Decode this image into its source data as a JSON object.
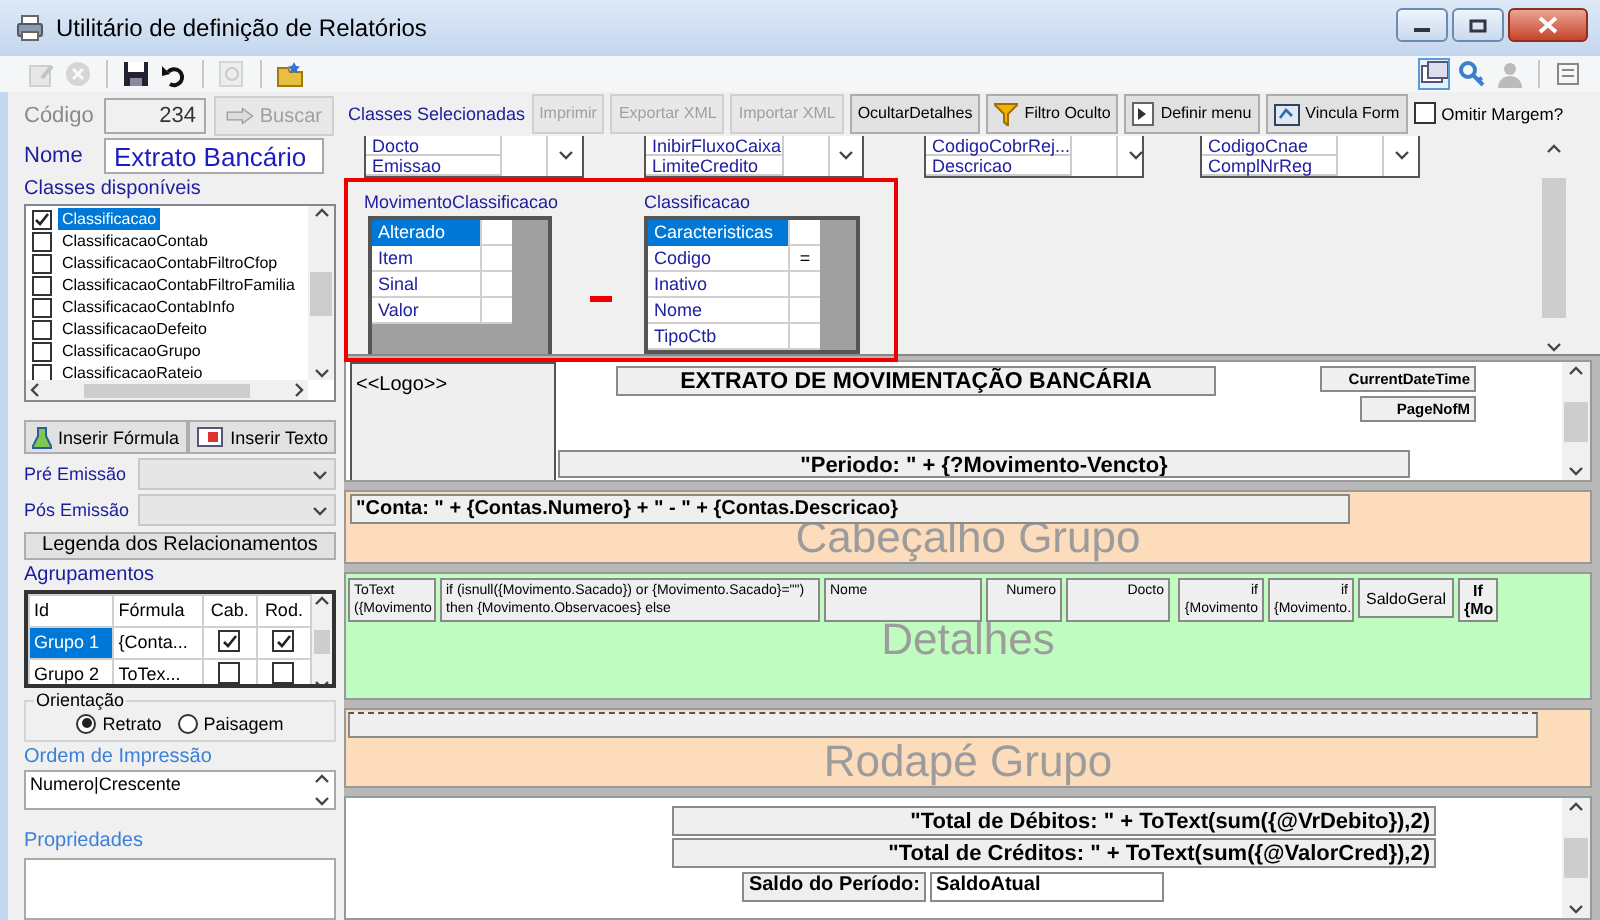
{
  "window": {
    "title": "Utilitário de definição de Relatórios"
  },
  "toolbar": [
    {
      "kind": "edit",
      "disabled": true
    },
    {
      "kind": "cancel",
      "disabled": true
    },
    {
      "kind": "save",
      "disabled": false
    },
    {
      "kind": "undo",
      "disabled": false
    },
    {
      "kind": "preview",
      "disabled": true
    },
    {
      "kind": "folder",
      "disabled": false
    }
  ],
  "right_tools": [
    {
      "kind": "windows",
      "selected": true
    },
    {
      "kind": "key",
      "selected": false
    },
    {
      "kind": "user",
      "selected": false
    },
    {
      "kind": "list",
      "selected": false
    }
  ],
  "codigo": {
    "label": "Código",
    "value": "234"
  },
  "buscar": {
    "label": "Buscar",
    "disabled": true
  },
  "nome": {
    "label": "Nome",
    "value": "Extrato Bancário"
  },
  "classes_selecionadas": {
    "label": "Classes Selecionadas"
  },
  "action_buttons": [
    {
      "label": "Imprimir",
      "kind": "plain",
      "disabled": true
    },
    {
      "label": "Exportar XML",
      "kind": "plain",
      "disabled": true
    },
    {
      "label": "Importar XML",
      "kind": "plain",
      "disabled": true
    },
    {
      "label": "OcultarDetalhes",
      "kind": "plain",
      "disabled": false
    },
    {
      "label": "Filtro Oculto",
      "kind": "filter",
      "disabled": false
    },
    {
      "label": "Definir menu",
      "kind": "menu",
      "disabled": false
    },
    {
      "label": "Vincula Form",
      "kind": "form",
      "disabled": false
    }
  ],
  "omitir_margem": {
    "label": "Omitir Margem?",
    "checked": false
  },
  "classes_disponiveis": {
    "label": "Classes disponíveis",
    "items": [
      {
        "label": "Classificacao",
        "checked": true,
        "selected": true
      },
      {
        "label": "ClassificacaoContab",
        "checked": false,
        "selected": false
      },
      {
        "label": "ClassificacaoContabFiltroCfop",
        "checked": false,
        "selected": false
      },
      {
        "label": "ClassificacaoContabFiltroFamilia",
        "checked": false,
        "selected": false
      },
      {
        "label": "ClassificacaoContabInfo",
        "checked": false,
        "selected": false
      },
      {
        "label": "ClassificacaoDefeito",
        "checked": false,
        "selected": false
      },
      {
        "label": "ClassificacaoGrupo",
        "checked": false,
        "selected": false
      },
      {
        "label": "ClassificacaoRateio",
        "checked": false,
        "selected": false
      }
    ]
  },
  "insert_buttons": [
    {
      "label": "Inserir Fórmula",
      "kind": "formula"
    },
    {
      "label": "Inserir Texto",
      "kind": "text"
    }
  ],
  "emissao": [
    {
      "label": "Pré Emissão"
    },
    {
      "label": "Pós Emissão"
    }
  ],
  "legenda_button": {
    "label": "Legenda dos Relacionamentos"
  },
  "agrupamentos": {
    "label": "Agrupamentos",
    "columns": [
      "Id",
      "Fórmula",
      "Cab.",
      "Rod."
    ],
    "rows": [
      {
        "id": "Grupo 1",
        "formula": "{Conta...",
        "cab": true,
        "rod": true,
        "selected": true
      },
      {
        "id": "Grupo 2",
        "formula": "ToTex...",
        "cab": false,
        "rod": false,
        "selected": false
      }
    ]
  },
  "orientacao": {
    "label": "Orientação",
    "options": [
      {
        "label": "Retrato",
        "selected": true
      },
      {
        "label": "Paisagem",
        "selected": false
      }
    ]
  },
  "ordem_impressao": {
    "label": "Ordem de Impressão",
    "value": "Numero|Crescente"
  },
  "propriedades": {
    "label": "Propriedades"
  },
  "diagram": {
    "stub_tables": [
      {
        "rows": [
          "Docto",
          "Emissao"
        ]
      },
      {
        "rows": [
          "InibirFluxoCaixa",
          "LimiteCredito"
        ]
      },
      {
        "rows": [
          "CodigoCobrRej...",
          "Descricao"
        ]
      },
      {
        "rows": [
          "CodigoCnae",
          "ComplNrReg"
        ]
      }
    ],
    "tables": [
      {
        "title": "MovimentoClassificacao",
        "rows": [
          {
            "label": "Alterado",
            "key": "",
            "selected": true
          },
          {
            "label": "Item",
            "key": "",
            "selected": false
          },
          {
            "label": "Sinal",
            "key": "",
            "selected": false
          },
          {
            "label": "Valor",
            "key": "",
            "selected": false
          }
        ]
      },
      {
        "title": "Classificacao",
        "rows": [
          {
            "label": "Caracteristicas",
            "key": "",
            "selected": true
          },
          {
            "label": "Codigo",
            "key": "=",
            "selected": false
          },
          {
            "label": "Inativo",
            "key": "",
            "selected": false
          },
          {
            "label": "Nome",
            "key": "",
            "selected": false
          },
          {
            "label": "TipoCtb",
            "key": "",
            "selected": false
          }
        ]
      }
    ]
  },
  "report": {
    "sections": [
      {
        "kind": "page-header",
        "fields": [
          {
            "kind": "logo",
            "text": "<<Logo>>"
          },
          {
            "kind": "title",
            "text": "EXTRATO DE MOVIMENTAÇÃO BANCÁRIA"
          },
          {
            "kind": "tag",
            "text": "CurrentDateTime"
          },
          {
            "kind": "tag",
            "text": "PageNofM"
          },
          {
            "kind": "formula",
            "text": "\"Periodo: \" + {?Movimento-Vencto}"
          }
        ]
      },
      {
        "kind": "group-header",
        "label": "Cabeçalho Grupo",
        "fields": [
          {
            "kind": "formula-left",
            "text": "\"Conta: \" + {Contas.Numero} + \" - \" + {Contas.Descricao}"
          }
        ]
      },
      {
        "kind": "details",
        "label": "Detalhes",
        "fields": [
          {
            "kind": "small",
            "text": "ToText ({Movimento"
          },
          {
            "kind": "small",
            "text": "if (isnull({Movimento.Sacado}) or {Movimento.Sacado}=\"\") then {Movimento.Observacoes} else"
          },
          {
            "kind": "small",
            "text": "Nome"
          },
          {
            "kind": "small-right",
            "text": "Numero"
          },
          {
            "kind": "small-right",
            "text": "Docto"
          },
          {
            "kind": "small-right",
            "text": "if {Movimento"
          },
          {
            "kind": "small-right",
            "text": "if {Movimento."
          },
          {
            "kind": "small-center",
            "text": "SaldoGeral"
          },
          {
            "kind": "small-bold",
            "text": "If {Mo"
          }
        ]
      },
      {
        "kind": "group-footer",
        "label": "Rodapé Grupo",
        "fields": [
          {
            "kind": "line"
          }
        ]
      },
      {
        "kind": "report-footer",
        "fields": [
          {
            "kind": "formula-right",
            "text": "\"Total de Débitos: \" + ToText(sum({@VrDebito}),2)"
          },
          {
            "kind": "formula-right",
            "text": "\"Total de Créditos: \" + ToText(sum({@ValorCred}),2)"
          },
          {
            "kind": "label-right",
            "text": "Saldo do Período:"
          },
          {
            "kind": "value",
            "text": "SaldoAtual"
          }
        ]
      }
    ]
  }
}
